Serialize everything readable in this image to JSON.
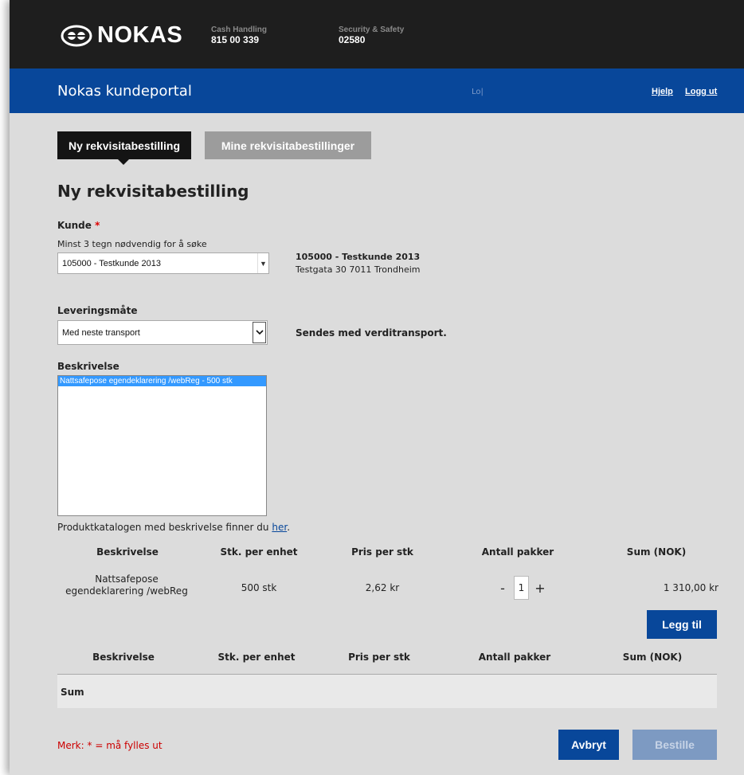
{
  "header": {
    "brand": "NOKAS",
    "contacts": [
      {
        "label": "Cash Handling",
        "number": "815 00 339"
      },
      {
        "label": "Security & Safety",
        "number": "02580"
      }
    ]
  },
  "nav": {
    "portal_title": "Nokas kundeportal",
    "truncated_text": "Lo|",
    "help": "Hjelp",
    "logout": "Logg ut"
  },
  "tabs": [
    {
      "label": "Ny rekvisitabestilling",
      "active": true
    },
    {
      "label": "Mine rekvisitabestillinger",
      "active": false
    }
  ],
  "form": {
    "title": "Ny rekvisitabestilling",
    "customer_label": "Kunde",
    "required_mark": "*",
    "customer_hint": "Minst 3 tegn nødvendig for å søke",
    "customer_value": "105000 - Testkunde 2013",
    "customer_address_name": "105000 - Testkunde 2013",
    "customer_address_street": "Testgata 30 7011 Trondheim",
    "delivery_label": "Leveringsmåte",
    "delivery_value": "Med neste transport",
    "delivery_note": "Sendes med verditransport.",
    "description_label": "Beskrivelse",
    "description_options": [
      "Nattsafepose egendeklarering /webReg - 500 stk"
    ],
    "catalog_text": "Produktkatalogen med beskrivelse finner du",
    "catalog_link": "her",
    "catalog_end": "."
  },
  "product_table": {
    "headers": [
      "Beskrivelse",
      "Stk. per enhet",
      "Pris per stk",
      "Antall pakker",
      "Sum (NOK)"
    ],
    "row": {
      "description_line1": "Nattsafepose",
      "description_line2": "egendeklarering /webReg",
      "units": "500 stk",
      "price": "2,62 kr",
      "qty": "1",
      "minus": "-",
      "plus": "+",
      "sum": "1 310,00 kr"
    },
    "add_button": "Legg til"
  },
  "order_table": {
    "headers": [
      "Beskrivelse",
      "Stk. per enhet",
      "Pris per stk",
      "Antall pakker",
      "Sum (NOK)"
    ],
    "sum_label": "Sum"
  },
  "footer": {
    "note_prefix": "Merk:",
    "note_star": "*",
    "note_suffix": "= må fylles ut",
    "cancel": "Avbryt",
    "order": "Bestille"
  },
  "colors": {
    "topbar": "#1e1e1e",
    "bluebar": "#08479a",
    "background": "#dcdcdc",
    "required": "#dd0000"
  }
}
